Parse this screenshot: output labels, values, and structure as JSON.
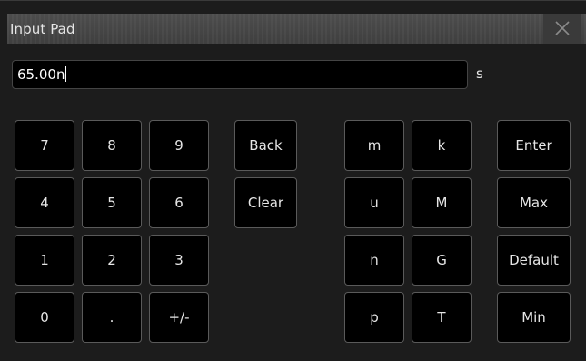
{
  "dialog": {
    "title": "Input Pad",
    "value": "65.00n",
    "unit": "s"
  },
  "keys": {
    "digit_7": "7",
    "digit_8": "8",
    "digit_9": "9",
    "digit_4": "4",
    "digit_5": "5",
    "digit_6": "6",
    "digit_1": "1",
    "digit_2": "2",
    "digit_3": "3",
    "digit_0": "0",
    "dot": ".",
    "sign": "+/-",
    "back": "Back",
    "clear": "Clear",
    "prefix_m": "m",
    "prefix_k": "k",
    "prefix_u": "u",
    "prefix_M": "M",
    "prefix_n": "n",
    "prefix_G": "G",
    "prefix_p": "p",
    "prefix_T": "T",
    "enter": "Enter",
    "max": "Max",
    "default": "Default",
    "min": "Min"
  },
  "icons": {
    "close": "close-icon"
  },
  "colors": {
    "title_bar": "#454545",
    "dialog_bg": "#1c1c1c",
    "key_bg": "#000000",
    "key_border": "#5a5a5a",
    "text": "#e6e6e6"
  }
}
